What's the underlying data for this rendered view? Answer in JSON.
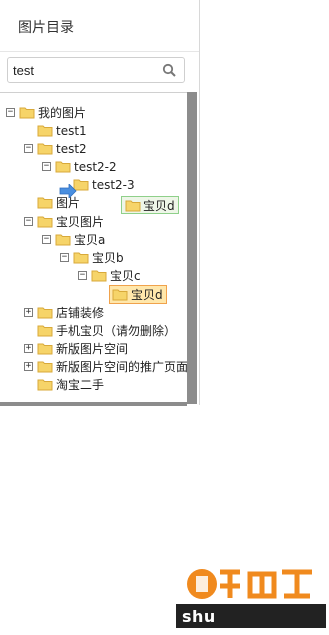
{
  "panel": {
    "title": "图片目录"
  },
  "search": {
    "value": "test"
  },
  "tree": [
    {
      "label": "我的图片",
      "toggle": "−"
    },
    {
      "label": "test1",
      "toggle": ""
    },
    {
      "label": "test2",
      "toggle": "−"
    },
    {
      "label": "test2-2",
      "toggle": "−"
    },
    {
      "label": "test2-3",
      "toggle": ""
    },
    {
      "label": "图片",
      "toggle": ""
    },
    {
      "label": "宝贝图片",
      "toggle": "−"
    },
    {
      "label": "宝贝a",
      "toggle": "−"
    },
    {
      "label": "宝贝b",
      "toggle": "−"
    },
    {
      "label": "宝贝c",
      "toggle": "−"
    },
    {
      "label": "宝贝d",
      "toggle": "",
      "selected": true
    },
    {
      "label": "店铺装修",
      "toggle": "+"
    },
    {
      "label": "手机宝贝（请勿删除）",
      "toggle": ""
    },
    {
      "label": "新版图片空间",
      "toggle": "+"
    },
    {
      "label": "新版图片空间的推广页面",
      "toggle": "+"
    },
    {
      "label": "淘宝二手",
      "toggle": ""
    }
  ],
  "drag_item": {
    "label": "宝贝d"
  },
  "watermark": {
    "text": "shu"
  },
  "colors": {
    "folder": "#f6d469",
    "folder_edge": "#d8a93a",
    "selection": "#ffe7ab",
    "selection_border": "#f0a24c",
    "drag_border": "#8fd08a",
    "scrollbar": "#8c8c8c"
  },
  "icons": {
    "search": "search-icon",
    "folder": "folder-icon",
    "drop_arrow": "drop-arrow-icon"
  }
}
